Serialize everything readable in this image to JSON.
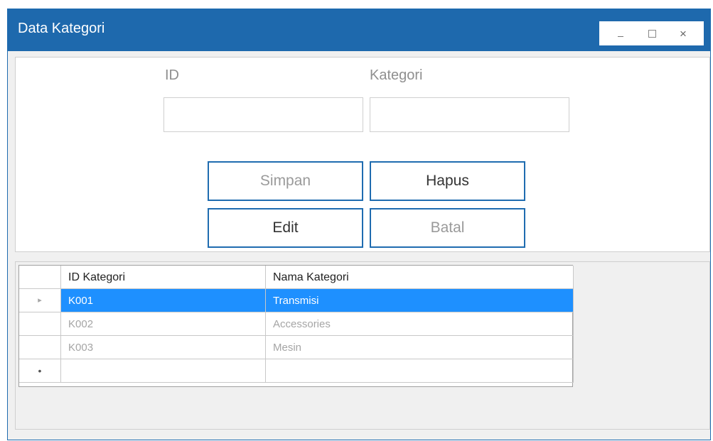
{
  "window": {
    "title": "Data Kategori",
    "controls": {
      "minimize": "_",
      "maximize": "□",
      "close": "×"
    }
  },
  "form": {
    "id_label": "ID",
    "kategori_label": "Kategori",
    "id_value": "",
    "kategori_value": ""
  },
  "buttons": {
    "simpan": "Simpan",
    "hapus": "Hapus",
    "edit": "Edit",
    "batal": "Batal"
  },
  "grid": {
    "columns": [
      "ID Kategori",
      "Nama Kategori"
    ],
    "rows": [
      {
        "id": "K001",
        "nama": "Transmisi",
        "selected": true,
        "indicator": "▸"
      },
      {
        "id": "K002",
        "nama": "Accessories",
        "selected": false,
        "indicator": ""
      },
      {
        "id": "K003",
        "nama": "Mesin",
        "selected": false,
        "indicator": ""
      }
    ],
    "new_row_indicator": "•"
  },
  "colors": {
    "titlebar": "#1e69ad",
    "button_border": "#1f6cb0",
    "selection": "#1e90ff"
  }
}
